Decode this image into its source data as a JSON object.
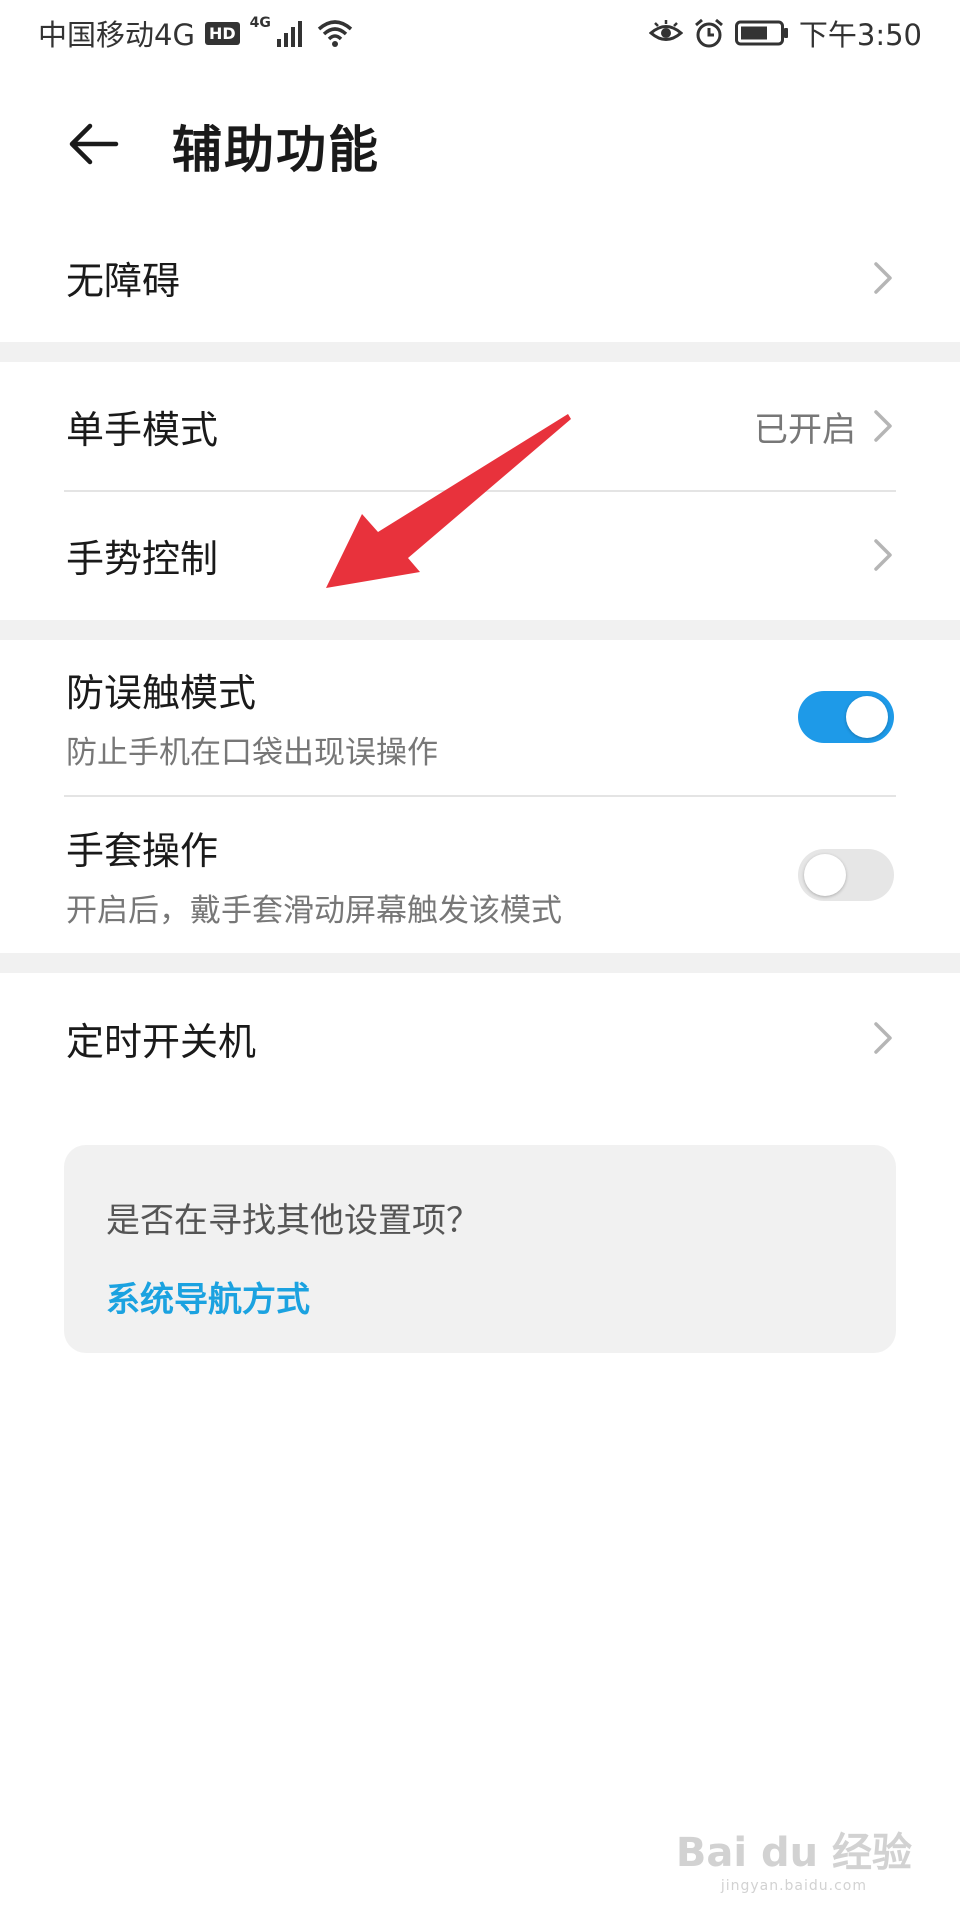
{
  "status_bar": {
    "carrier": "中国移动4G",
    "hd_badge": "HD",
    "signal_badge": "4G",
    "time": "下午3:50",
    "icons": [
      "eye-icon",
      "alarm-icon",
      "battery-icon"
    ]
  },
  "header": {
    "title": "辅助功能",
    "back_icon": "back-arrow-icon"
  },
  "rows": {
    "accessibility": {
      "label": "无障碍"
    },
    "one_hand": {
      "label": "单手模式",
      "value": "已开启"
    },
    "gesture": {
      "label": "手势控制"
    },
    "anti_mistouch": {
      "label": "防误触模式",
      "sub": "防止手机在口袋出现误操作",
      "enabled": true
    },
    "glove": {
      "label": "手套操作",
      "sub": "开启后，戴手套滑动屏幕触发该模式",
      "enabled": false
    },
    "scheduled_power": {
      "label": "定时开关机"
    }
  },
  "hint": {
    "question": "是否在寻找其他设置项？",
    "link": "系统导航方式"
  },
  "watermark": {
    "brand": "Bai du 经验",
    "url": "jingyan.baidu.com"
  },
  "colors": {
    "accent": "#1e9ae8",
    "link": "#1ba2e0",
    "annotation": "#e8323c"
  }
}
